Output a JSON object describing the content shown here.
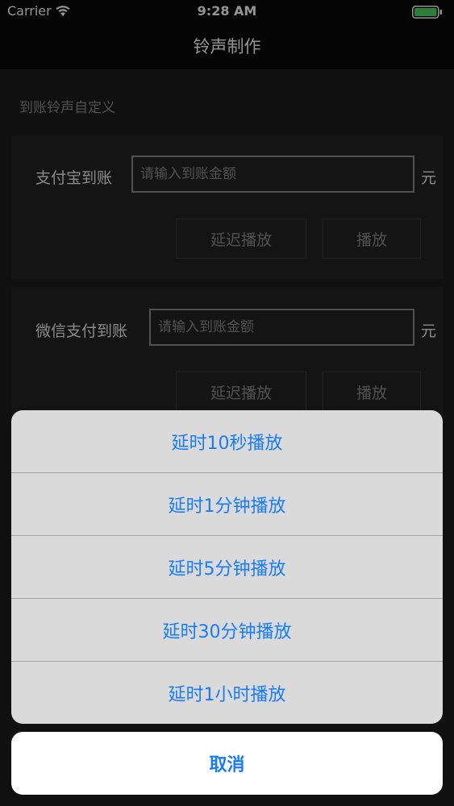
{
  "status_bar": {
    "carrier": "Carrier",
    "time": "9:28 AM",
    "battery_color": "#4cd964",
    "wifi_icon": "wifi-icon",
    "battery_icon": "battery-icon"
  },
  "nav": {
    "title": "铃声制作"
  },
  "section": {
    "header": "到账铃声自定义"
  },
  "rows": [
    {
      "label": "支付宝到账",
      "placeholder": "请输入到账金额",
      "unit": "元",
      "delay_button": "延迟播放",
      "play_button": "播放"
    },
    {
      "label": "微信支付到账",
      "placeholder": "请输入到账金额",
      "unit": "元",
      "delay_button": "延迟播放",
      "play_button": "播放"
    }
  ],
  "action_sheet": {
    "options": [
      "延时10秒播放",
      "延时1分钟播放",
      "延时5分钟播放",
      "延时30分钟播放",
      "延时1小时播放"
    ],
    "cancel": "取消",
    "accent_color": "#1a7cf5"
  }
}
